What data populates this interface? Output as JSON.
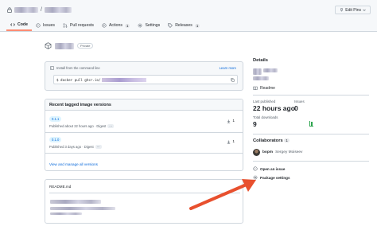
{
  "header": {
    "separator": "/",
    "edit_pins_label": "Edit Pins"
  },
  "tabs": [
    {
      "label": "Code",
      "count": null
    },
    {
      "label": "Issues",
      "count": null
    },
    {
      "label": "Pull requests",
      "count": null
    },
    {
      "label": "Actions",
      "count": "1"
    },
    {
      "label": "Settings",
      "count": null
    },
    {
      "label": "Releases",
      "count": "1"
    }
  ],
  "package": {
    "visibility_badge": "Private",
    "install_label": "Install from the command line",
    "learn_more": "Learn more",
    "command": "$ docker pull ghcr.io/"
  },
  "versions": {
    "title": "Recent tagged image versions",
    "items": [
      {
        "tag": "0.1.1",
        "meta": "Published about 22 hours ago · Digest",
        "more": "···",
        "downloads": "1"
      },
      {
        "tag": "0.1.0",
        "meta": "Published 3 days ago · Digest",
        "more": "···",
        "downloads": "1"
      }
    ],
    "view_all": "View and manage all versions"
  },
  "readme": {
    "title": "README.md"
  },
  "sidebar": {
    "details_title": "Details",
    "readme_link": "Readme",
    "last_published_label": "Last published",
    "last_published_value": "22 hours ago",
    "issues_label": "Issues",
    "issues_value": "0",
    "total_downloads_label": "Total downloads",
    "total_downloads_value": "9",
    "collaborators_title": "Collaborators",
    "collaborators_count": "1",
    "collaborator_login": "bopm",
    "collaborator_name": "Sergey Moiseev",
    "open_issue": "Open an issue",
    "package_settings": "Package settings"
  },
  "colors": {
    "accent": "#0969da",
    "active_tab": "#fd8c73",
    "arrow": "#e8502e",
    "graph": "#2da44e"
  }
}
